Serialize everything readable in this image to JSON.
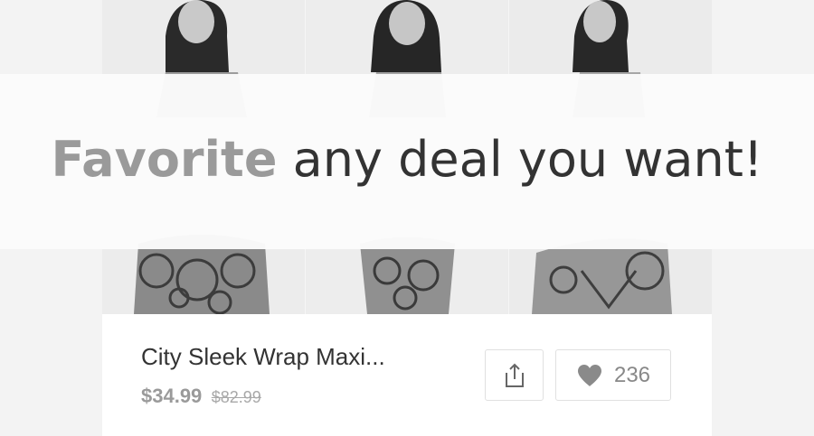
{
  "banner": {
    "highlight": "Favorite",
    "rest": " any deal you want!"
  },
  "deal": {
    "title": "City Sleek Wrap Maxi...",
    "price": "$34.99",
    "original_price": "$82.99",
    "favorites_count": "236",
    "photos": [
      "model-photo-front",
      "model-photo-angle",
      "model-photo-side"
    ]
  },
  "icons": {
    "share": "share-icon",
    "favorite": "heart-icon"
  },
  "colors": {
    "highlight_text": "#9a9a9a",
    "main_text": "#333333",
    "price_text": "#9a9a9a",
    "card_bg": "#ffffff",
    "page_bg": "#f3f3f3"
  }
}
